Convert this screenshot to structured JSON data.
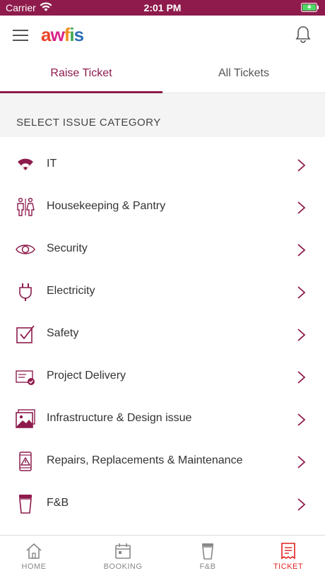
{
  "status_bar": {
    "carrier": "Carrier",
    "time": "2:01 PM"
  },
  "header": {
    "logo": {
      "a": "a",
      "w": "w",
      "f": "f",
      "i": "i",
      "s": "s"
    },
    "menu_icon": "hamburger-icon",
    "notification_icon": "bell-icon"
  },
  "tabs": [
    {
      "label": "Raise Ticket",
      "active": true
    },
    {
      "label": "All Tickets",
      "active": false
    }
  ],
  "section_title": "SELECT ISSUE CATEGORY",
  "categories": [
    {
      "label": "IT",
      "icon": "wifi-icon"
    },
    {
      "label": "Housekeeping & Pantry",
      "icon": "restroom-icon"
    },
    {
      "label": "Security",
      "icon": "eye-icon"
    },
    {
      "label": "Electricity",
      "icon": "plug-icon"
    },
    {
      "label": "Safety",
      "icon": "checkbox-icon"
    },
    {
      "label": "Project Delivery",
      "icon": "document-check-icon"
    },
    {
      "label": "Infrastructure & Design issue",
      "icon": "image-icon"
    },
    {
      "label": "Repairs, Replacements & Maintenance",
      "icon": "phone-warning-icon"
    },
    {
      "label": "F&B",
      "icon": "cup-icon"
    }
  ],
  "bottom_nav": [
    {
      "label": "HOME",
      "icon": "home-icon",
      "active": false
    },
    {
      "label": "BOOKING",
      "icon": "calendar-icon",
      "active": false
    },
    {
      "label": "F&B",
      "icon": "cup-icon",
      "active": false
    },
    {
      "label": "TICKET",
      "icon": "ticket-icon",
      "active": true
    }
  ],
  "colors": {
    "brand": "#8e1b4c",
    "active_nav": "#e02020",
    "section_bg": "#f4f4f4",
    "logo_a": "#e8462a",
    "logo_w": "#d8228a",
    "logo_f": "#f28c1e",
    "logo_i": "#3aa94d",
    "logo_s": "#2e6fb7"
  }
}
